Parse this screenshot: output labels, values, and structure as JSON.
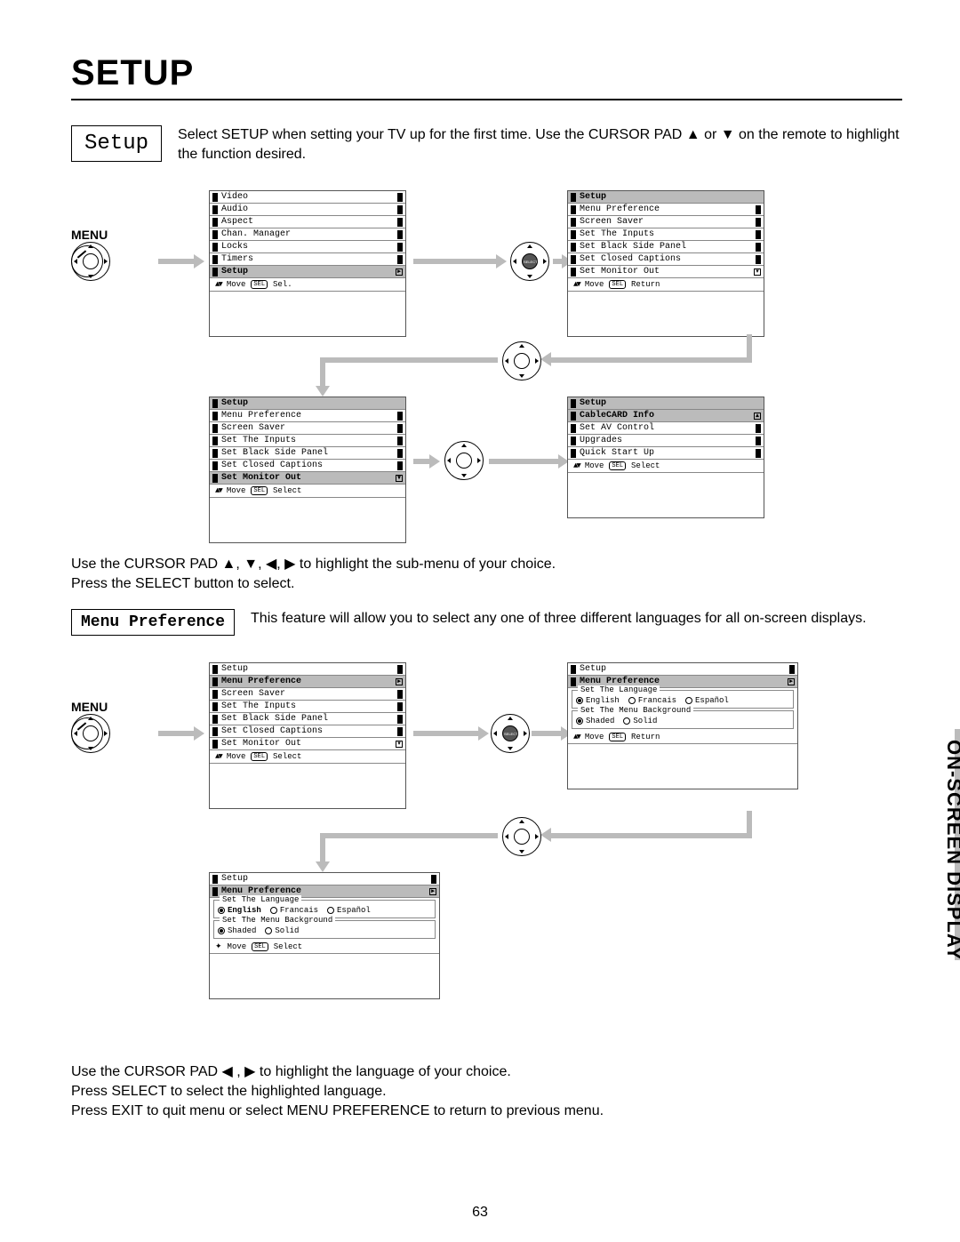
{
  "page_title": "SETUP",
  "section_label": "Setup",
  "intro_text": "Select SETUP when setting your TV up for the first time.  Use the CURSOR PAD ▲ or ▼ on the remote to highlight the function desired.",
  "menu_label": "MENU",
  "body_text_1a": "Use the CURSOR PAD ▲, ▼, ◀, ▶ to highlight the sub-menu of your choice.",
  "body_text_1b": "Press the SELECT button to select.",
  "menu_pref_label": "Menu Preference",
  "menu_pref_text": "This feature will allow you to select any one of three different languages for all on-screen displays.",
  "body_text_2a": "Use the CURSOR PAD ◀ , ▶ to highlight the language of your choice.",
  "body_text_2b": "Press SELECT to select the highlighted language.",
  "body_text_2c": "Press EXIT to quit menu or select MENU PREFERENCE to return to previous menu.",
  "page_number": "63",
  "side_tab": "ON-SCREEN DISPLAY",
  "osd_main_menu": {
    "items": [
      "Video",
      "Audio",
      "Aspect",
      "Chan. Manager",
      "Locks",
      "Timers",
      "Setup"
    ],
    "highlight": "Setup",
    "footer_move": "Move",
    "footer_sel": "Sel."
  },
  "osd_setup_list": {
    "header": "Setup",
    "items": [
      "Menu Preference",
      "Screen Saver",
      "Set The Inputs",
      "Set Black Side Panel",
      "Set Closed Captions",
      "Set Monitor Out"
    ],
    "footer_move": "Move",
    "footer_sel": "Return"
  },
  "osd_setup_list_scroll": {
    "header": "Setup",
    "items": [
      "Menu Preference",
      "Screen Saver",
      "Set The Inputs",
      "Set Black Side Panel",
      "Set Closed Captions",
      "Set Monitor Out"
    ],
    "highlight": "Set Monitor Out",
    "footer_move": "Move",
    "footer_sel": "Select"
  },
  "osd_setup_list_page2": {
    "header": "Setup",
    "items": [
      "CableCARD Info",
      "Set AV Control",
      "Upgrades",
      "Quick Start Up"
    ],
    "highlight": "CableCARD Info",
    "footer_move": "Move",
    "footer_sel": "Select"
  },
  "osd_setup_menupref_hl": {
    "header": "Setup",
    "items": [
      "Menu Preference",
      "Screen Saver",
      "Set The Inputs",
      "Set Black Side Panel",
      "Set Closed Captions",
      "Set Monitor Out"
    ],
    "highlight": "Menu Preference",
    "footer_move": "Move",
    "footer_sel": "Select"
  },
  "osd_menupref_options": {
    "header": "Setup",
    "subheader": "Menu Preference",
    "group1_label": "Set The Language",
    "group1_opts": [
      "English",
      "Francais",
      "Español"
    ],
    "group1_selected": "English",
    "group2_label": "Set The Menu Background",
    "group2_opts": [
      "Shaded",
      "Solid"
    ],
    "group2_selected": "Shaded",
    "footer_move": "Move",
    "footer_return": "Return"
  },
  "osd_menupref_options_select": {
    "header": "Setup",
    "subheader": "Menu Preference",
    "group1_label": "Set The Language",
    "group1_opts": [
      "English",
      "Francais",
      "Español"
    ],
    "group1_selected": "English",
    "group2_label": "Set The Menu Background",
    "group2_opts": [
      "Shaded",
      "Solid"
    ],
    "group2_selected": "Shaded",
    "footer_move": "Move",
    "footer_sel": "Select"
  }
}
